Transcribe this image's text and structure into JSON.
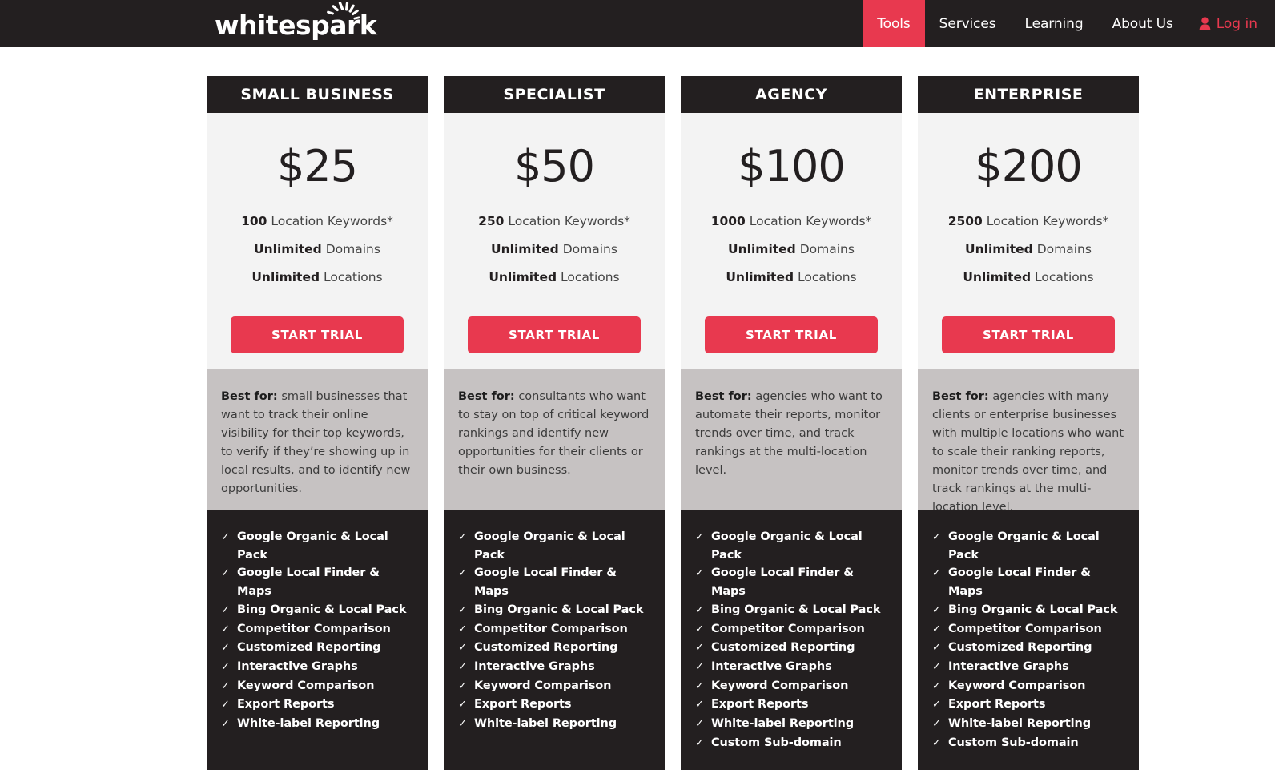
{
  "header": {
    "brand": "whitespark",
    "brand_icon": "spark-icon",
    "nav": [
      {
        "label": "Tools",
        "active": true
      },
      {
        "label": "Services",
        "active": false
      },
      {
        "label": "Learning",
        "active": false
      },
      {
        "label": "About Us",
        "active": false
      }
    ],
    "login": {
      "label": "Log in",
      "icon": "user-icon"
    },
    "colors": {
      "background": "#231f20",
      "accent": "#e8394f",
      "text": "#ffffff"
    }
  },
  "pricing": {
    "cta_label": "START TRIAL",
    "check_glyph": "✓",
    "colors": {
      "header_bg": "#231f20",
      "body_bg": "#f3f3f3",
      "desc_bg": "#c6c2c2",
      "features_bg": "#231f20",
      "cta_bg": "#e8394f"
    },
    "plans": [
      {
        "name": "SMALL BUSINESS",
        "price": "$25",
        "specs": [
          {
            "value": "100",
            "label": " Location Keywords*"
          },
          {
            "value": "Unlimited",
            "label": " Domains"
          },
          {
            "value": "Unlimited",
            "label": " Locations"
          }
        ],
        "best_for_label": "Best for:",
        "best_for_text": " small businesses that want to track their online visibility for their top keywords, to verify if they’re showing up in local results, and to identify new opportunities.",
        "features": [
          "Google Organic & Local Pack",
          "Google Local Finder & Maps",
          "Bing Organic & Local Pack",
          "Competitor Comparison",
          "Customized Reporting",
          "Interactive Graphs",
          "Keyword Comparison",
          "Export Reports",
          "White-label Reporting"
        ]
      },
      {
        "name": "SPECIALIST",
        "price": "$50",
        "specs": [
          {
            "value": "250",
            "label": " Location Keywords*"
          },
          {
            "value": "Unlimited",
            "label": " Domains"
          },
          {
            "value": "Unlimited",
            "label": " Locations"
          }
        ],
        "best_for_label": "Best for:",
        "best_for_text": " consultants who want to stay on top of critical keyword rankings and identify new opportunities for their clients or their own business.",
        "features": [
          "Google Organic & Local Pack",
          "Google Local Finder & Maps",
          "Bing Organic & Local Pack",
          "Competitor Comparison",
          "Customized Reporting",
          "Interactive Graphs",
          "Keyword Comparison",
          "Export Reports",
          "White-label Reporting"
        ]
      },
      {
        "name": "AGENCY",
        "price": "$100",
        "specs": [
          {
            "value": "1000",
            "label": " Location Keywords*"
          },
          {
            "value": "Unlimited",
            "label": " Domains"
          },
          {
            "value": "Unlimited",
            "label": " Locations"
          }
        ],
        "best_for_label": "Best for:",
        "best_for_text": " agencies who want to automate their reports, monitor trends over time, and track rankings at the multi-location level.",
        "features": [
          "Google Organic & Local Pack",
          "Google Local Finder & Maps",
          "Bing Organic & Local Pack",
          "Competitor Comparison",
          "Customized Reporting",
          "Interactive Graphs",
          "Keyword Comparison",
          "Export Reports",
          "White-label Reporting",
          "Custom Sub-domain"
        ]
      },
      {
        "name": "ENTERPRISE",
        "price": "$200",
        "specs": [
          {
            "value": "2500",
            "label": " Location Keywords*"
          },
          {
            "value": "Unlimited",
            "label": " Domains"
          },
          {
            "value": "Unlimited",
            "label": " Locations"
          }
        ],
        "best_for_label": "Best for:",
        "best_for_text": " agencies with many clients or enterprise businesses with multiple locations who want to scale their ranking reports, monitor trends over time, and track rankings at the multi-location level.",
        "features": [
          "Google Organic & Local Pack",
          "Google Local Finder & Maps",
          "Bing Organic & Local Pack",
          "Competitor Comparison",
          "Customized Reporting",
          "Interactive Graphs",
          "Keyword Comparison",
          "Export Reports",
          "White-label Reporting",
          "Custom Sub-domain"
        ]
      }
    ]
  }
}
